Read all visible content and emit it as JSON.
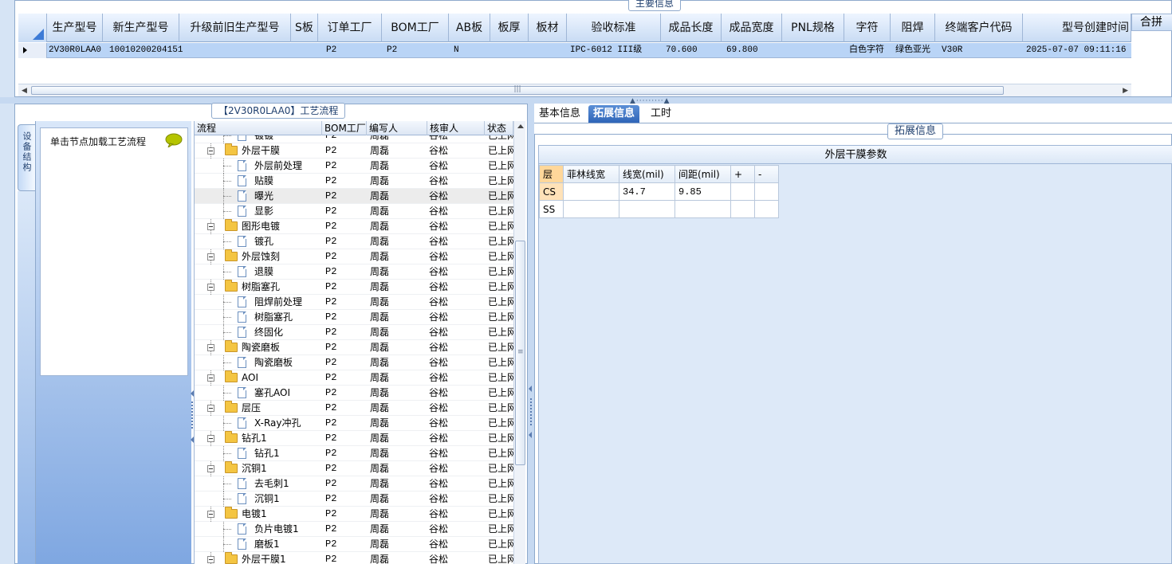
{
  "top": {
    "group_title": "主要信息",
    "merge_label": "合拼",
    "columns": [
      "生产型号",
      "新生产型号",
      "升级前旧生产型号",
      "S板",
      "订单工厂",
      "BOM工厂",
      "AB板",
      "板厚",
      "板材",
      "验收标准",
      "成品长度",
      "成品宽度",
      "PNL规格",
      "字符",
      "阻焊",
      "终端客户代码",
      "型号创建时间"
    ],
    "row": [
      "2V30R0LAA0",
      "10010200204151",
      "",
      "",
      "P2",
      "P2",
      "N",
      "",
      "",
      "IPC-6012 III级",
      "70.600",
      "69.800",
      "",
      "白色字符",
      "绿色亚光",
      "V30R",
      "2025-07-07 09:11:16"
    ]
  },
  "left": {
    "process_title": "【2V30R0LAA0】工艺流程",
    "vertical_tab": "设备结构",
    "click_hint": "单击节点加载工艺流程"
  },
  "tree": {
    "headers": [
      "流程",
      "BOM工厂",
      "编写人",
      "核审人",
      "状态"
    ],
    "rows": [
      {
        "label": "镀镀",
        "level": 2,
        "type": "doc",
        "bom": "P2",
        "writer": "周磊",
        "reviewer": "谷松",
        "status": "已上网"
      },
      {
        "label": "外层干膜",
        "level": 1,
        "type": "folder",
        "bom": "P2",
        "writer": "周磊",
        "reviewer": "谷松",
        "status": "已上网"
      },
      {
        "label": "外层前处理",
        "level": 2,
        "type": "doc",
        "bom": "P2",
        "writer": "周磊",
        "reviewer": "谷松",
        "status": "已上网"
      },
      {
        "label": "贴膜",
        "level": 2,
        "type": "doc",
        "bom": "P2",
        "writer": "周磊",
        "reviewer": "谷松",
        "status": "已上网"
      },
      {
        "label": "曝光",
        "level": 2,
        "type": "doc",
        "bom": "P2",
        "writer": "周磊",
        "reviewer": "谷松",
        "status": "已上网",
        "selected": true
      },
      {
        "label": "显影",
        "level": 2,
        "type": "doc",
        "bom": "P2",
        "writer": "周磊",
        "reviewer": "谷松",
        "status": "已上网"
      },
      {
        "label": "图形电镀",
        "level": 1,
        "type": "folder",
        "bom": "P2",
        "writer": "周磊",
        "reviewer": "谷松",
        "status": "已上网"
      },
      {
        "label": "镀孔",
        "level": 2,
        "type": "doc",
        "bom": "P2",
        "writer": "周磊",
        "reviewer": "谷松",
        "status": "已上网"
      },
      {
        "label": "外层蚀刻",
        "level": 1,
        "type": "folder",
        "bom": "P2",
        "writer": "周磊",
        "reviewer": "谷松",
        "status": "已上网"
      },
      {
        "label": "退膜",
        "level": 2,
        "type": "doc",
        "bom": "P2",
        "writer": "周磊",
        "reviewer": "谷松",
        "status": "已上网"
      },
      {
        "label": "树脂塞孔",
        "level": 1,
        "type": "folder",
        "bom": "P2",
        "writer": "周磊",
        "reviewer": "谷松",
        "status": "已上网"
      },
      {
        "label": "阻焊前处理",
        "level": 2,
        "type": "doc",
        "bom": "P2",
        "writer": "周磊",
        "reviewer": "谷松",
        "status": "已上网"
      },
      {
        "label": "树脂塞孔",
        "level": 2,
        "type": "doc",
        "bom": "P2",
        "writer": "周磊",
        "reviewer": "谷松",
        "status": "已上网"
      },
      {
        "label": "终固化",
        "level": 2,
        "type": "doc",
        "bom": "P2",
        "writer": "周磊",
        "reviewer": "谷松",
        "status": "已上网"
      },
      {
        "label": "陶瓷磨板",
        "level": 1,
        "type": "folder",
        "bom": "P2",
        "writer": "周磊",
        "reviewer": "谷松",
        "status": "已上网"
      },
      {
        "label": "陶瓷磨板",
        "level": 2,
        "type": "doc",
        "bom": "P2",
        "writer": "周磊",
        "reviewer": "谷松",
        "status": "已上网"
      },
      {
        "label": "AOI",
        "level": 1,
        "type": "folder",
        "bom": "P2",
        "writer": "周磊",
        "reviewer": "谷松",
        "status": "已上网"
      },
      {
        "label": "塞孔AOI",
        "level": 2,
        "type": "doc",
        "bom": "P2",
        "writer": "周磊",
        "reviewer": "谷松",
        "status": "已上网"
      },
      {
        "label": "层压",
        "level": 1,
        "type": "folder",
        "bom": "P2",
        "writer": "周磊",
        "reviewer": "谷松",
        "status": "已上网"
      },
      {
        "label": "X-Ray冲孔",
        "level": 2,
        "type": "doc",
        "bom": "P2",
        "writer": "周磊",
        "reviewer": "谷松",
        "status": "已上网"
      },
      {
        "label": "钻孔1",
        "level": 1,
        "type": "folder",
        "bom": "P2",
        "writer": "周磊",
        "reviewer": "谷松",
        "status": "已上网"
      },
      {
        "label": "钻孔1",
        "level": 2,
        "type": "doc",
        "bom": "P2",
        "writer": "周磊",
        "reviewer": "谷松",
        "status": "已上网"
      },
      {
        "label": "沉铜1",
        "level": 1,
        "type": "folder",
        "bom": "P2",
        "writer": "周磊",
        "reviewer": "谷松",
        "status": "已上网"
      },
      {
        "label": "去毛刺1",
        "level": 2,
        "type": "doc",
        "bom": "P2",
        "writer": "周磊",
        "reviewer": "谷松",
        "status": "已上网"
      },
      {
        "label": "沉铜1",
        "level": 2,
        "type": "doc",
        "bom": "P2",
        "writer": "周磊",
        "reviewer": "谷松",
        "status": "已上网"
      },
      {
        "label": "电镀1",
        "level": 1,
        "type": "folder",
        "bom": "P2",
        "writer": "周磊",
        "reviewer": "谷松",
        "status": "已上网"
      },
      {
        "label": "负片电镀1",
        "level": 2,
        "type": "doc",
        "bom": "P2",
        "writer": "周磊",
        "reviewer": "谷松",
        "status": "已上网"
      },
      {
        "label": "磨板1",
        "level": 2,
        "type": "doc",
        "bom": "P2",
        "writer": "周磊",
        "reviewer": "谷松",
        "status": "已上网"
      },
      {
        "label": "外层干膜1",
        "level": 1,
        "type": "folder",
        "bom": "P2",
        "writer": "周磊",
        "reviewer": "谷松",
        "status": "已上网"
      }
    ]
  },
  "right": {
    "tabs": [
      "基本信息",
      "拓展信息",
      "工时"
    ],
    "active_tab": 1,
    "ext_title": "拓展信息",
    "params_title": "外层干膜参数",
    "param_headers": [
      "层",
      "菲林线宽",
      "线宽(mil)",
      "间距(mil)",
      "+",
      "-"
    ],
    "param_rows": [
      [
        "CS",
        "",
        "34.7",
        "9.85",
        "",
        ""
      ],
      [
        "SS",
        "",
        "",
        "",
        "",
        ""
      ]
    ]
  },
  "colors": {
    "accent": "#2f65b8",
    "selected_row": "#b9d4f6",
    "panel_border": "#8ea9cc"
  }
}
